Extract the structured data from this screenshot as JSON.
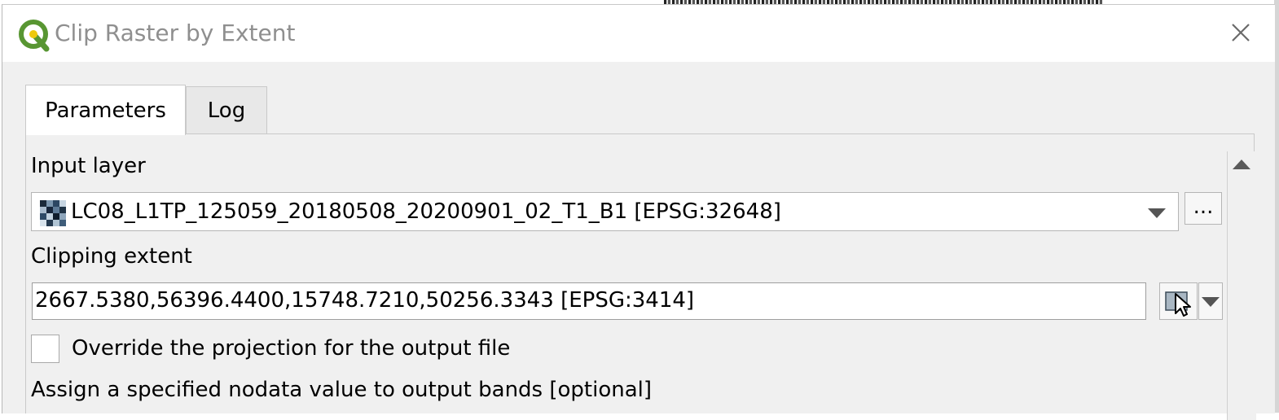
{
  "window": {
    "title": "Clip Raster by Extent",
    "logo_icon": "qgis-logo-icon",
    "close_icon": "close-icon"
  },
  "tabs": [
    {
      "label": "Parameters",
      "active": true
    },
    {
      "label": "Log",
      "active": false
    }
  ],
  "params": {
    "input_layer": {
      "label": "Input layer",
      "value": "LC08_L1TP_125059_20180508_20200901_02_T1_B1 [EPSG:32648]",
      "icon": "raster-layer-icon",
      "browse_label": "..."
    },
    "clipping_extent": {
      "label": "Clipping extent",
      "value": "2667.5380,56396.4400,15748.7210,50256.3343 [EPSG:3414]",
      "button_icon": "map-canvas-extent-icon"
    },
    "override_projection": {
      "label": "Override the projection for the output file",
      "checked": false
    },
    "nodata": {
      "label": "Assign a specified nodata value to output bands [optional]"
    }
  },
  "colors": {
    "qgis_green": "#589632",
    "qgis_yellow": "#eec90d",
    "dialog_bg": "#f0f0f0",
    "title_text": "#8f8f8f"
  }
}
